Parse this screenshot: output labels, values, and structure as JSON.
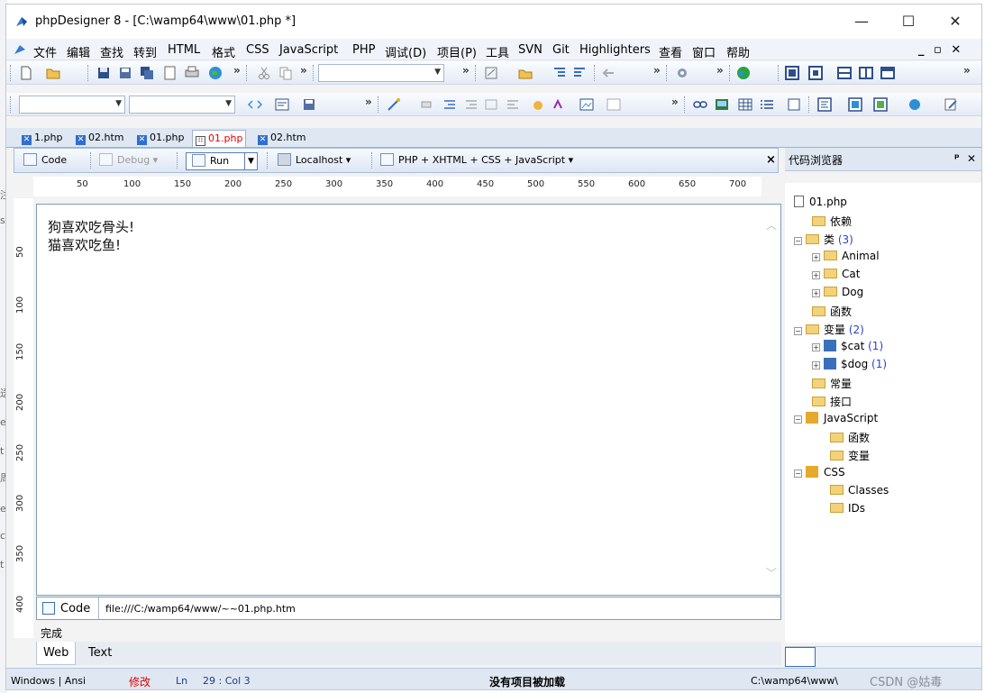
{
  "window": {
    "title": "phpDesigner 8 - [C:\\wamp64\\www\\01.php *]",
    "min_glyph": "—",
    "max_glyph": "☐",
    "close_glyph": "✕"
  },
  "menubar": {
    "items": [
      "文件",
      "编辑",
      "查找",
      "转到",
      "HTML",
      "格式",
      "CSS",
      "JavaScript",
      "PHP",
      "调试(D)",
      "项目(P)",
      "工具",
      "SVN",
      "Git",
      "Highlighters",
      "查看",
      "窗口",
      "帮助"
    ],
    "right_controls": "_ ▫ ✕"
  },
  "tabs": [
    {
      "label": "1.php"
    },
    {
      "label": "02.htm"
    },
    {
      "label": "01.php"
    },
    {
      "label": "01.php",
      "active": true
    },
    {
      "label": "02.htm"
    }
  ],
  "editor_toolbar": {
    "code": "Code",
    "debug": "Debug",
    "run": "Run",
    "localhost": "Localhost",
    "syntax": "PHP + XHTML + CSS + JavaScript",
    "close": "×"
  },
  "ruler": {
    "h_ticks": [
      "50",
      "100",
      "150",
      "200",
      "250",
      "300",
      "350",
      "400",
      "450",
      "500",
      "550",
      "600",
      "650",
      "700"
    ],
    "v_ticks": [
      "50",
      "100",
      "150",
      "200",
      "250",
      "300",
      "350",
      "400"
    ]
  },
  "editor": {
    "lines": [
      "狗喜欢吃骨头!",
      "猫喜欢吃鱼!"
    ]
  },
  "code_bar": {
    "label": "Code",
    "path": "file:///C:/wamp64/www/~~01.php.htm"
  },
  "status_label": "完成",
  "view_tabs": [
    "Web",
    "Text"
  ],
  "right_panel": {
    "title": "代码浏览器",
    "pin": "ᵖ",
    "close": "✕",
    "tree": [
      {
        "label": "01.php"
      },
      {
        "label": "依赖"
      },
      {
        "label": "类",
        "count": "(3)"
      },
      {
        "label": "Animal"
      },
      {
        "label": "Cat"
      },
      {
        "label": "Dog"
      },
      {
        "label": "函数"
      },
      {
        "label": "变量",
        "count": "(2)"
      },
      {
        "label": "$cat",
        "count": "(1)"
      },
      {
        "label": "$dog",
        "count": "(1)"
      },
      {
        "label": "常量"
      },
      {
        "label": "接口"
      },
      {
        "label": "JavaScript"
      },
      {
        "label": "函数"
      },
      {
        "label": "变量"
      },
      {
        "label": "CSS"
      },
      {
        "label": "Classes"
      },
      {
        "label": "IDs"
      }
    ]
  },
  "statusbar": {
    "encoding": "Windows | Ansi",
    "modified": "修改",
    "ln_label": "Ln",
    "ln_value": "29 : Col  3",
    "project": "没有项目被加载",
    "path": "C:\\wamp64\\www\\",
    "watermark": "CSDN @姑毒"
  },
  "colors": {
    "accent": "#2f6fd1",
    "modified": "#e00000",
    "count": "#2a3fd0"
  }
}
